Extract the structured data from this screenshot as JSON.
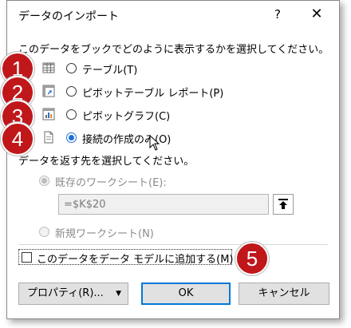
{
  "dialog": {
    "title": "データのインポート",
    "help_label": "?",
    "close_label": "✕"
  },
  "display": {
    "prompt": "このデータをブックでどのように表示するかを選択してください。",
    "options": [
      {
        "label": "テーブル(T)",
        "selected": false,
        "badge": "1",
        "icon": "table-icon"
      },
      {
        "label": "ピボットテーブル レポート(P)",
        "selected": false,
        "badge": "2",
        "icon": "pivot-table-icon"
      },
      {
        "label": "ピボットグラフ(C)",
        "selected": false,
        "badge": "3",
        "icon": "pivot-chart-icon"
      },
      {
        "label": "接続の作成のみ(O)",
        "selected": true,
        "badge": "4",
        "icon": "connection-icon"
      }
    ]
  },
  "destination": {
    "prompt": "データを返す先を選択してください。",
    "existing_sheet_label": "既存のワークシート(E):",
    "existing_selected": true,
    "cell_reference": "=$K$20",
    "new_sheet_label": "新規ワークシート(N)",
    "enabled": false
  },
  "data_model": {
    "label": "このデータをデータ モデルに追加する(M)",
    "checked": false,
    "badge": "5"
  },
  "buttons": {
    "properties": "プロパティ(R)...",
    "ok": "OK",
    "cancel": "キャンセル"
  },
  "colors": {
    "badge": "#c0171b",
    "radio_selected": "#1e6fd9",
    "default_button_border": "#0078d7"
  }
}
